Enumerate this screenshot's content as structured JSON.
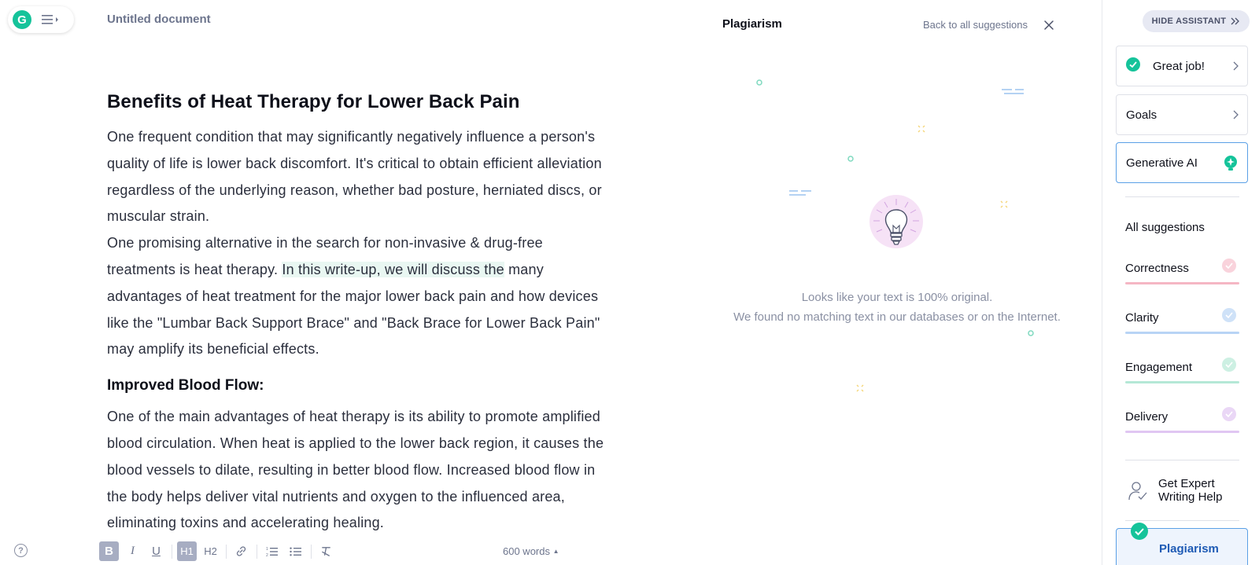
{
  "app": {
    "logo_letter": "G",
    "document_title": "Untitled document"
  },
  "editor": {
    "heading": "Benefits of Heat Therapy for Lower Back Pain",
    "para1": "One frequent condition that may significantly negatively influence a person's quality of life is lower back discomfort. It's critical to obtain efficient alleviation regardless of the underlying reason, whether bad posture, herniated discs, or muscular strain.",
    "para2_before": "One promising alternative in the search for non-invasive & drug-free treatments is heat therapy. ",
    "para2_highlight": "In this write-up, we will discuss the",
    "para2_after": " many advantages of heat treatment for the major lower back pain and how devices like the \"Lumbar Back Support Brace\" and \"Back Brace for Lower Back Pain\" may amplify its beneficial effects.",
    "subheading": "Improved Blood Flow:",
    "para3": "One of the main advantages of heat therapy is its ability to promote amplified blood circulation. When heat is applied to the lower back region, it causes the blood vessels to dilate, resulting in better blood flow. Increased blood flow in the body helps deliver vital nutrients and oxygen to the influenced area, eliminating toxins and accelerating healing."
  },
  "toolbar": {
    "bold": "B",
    "italic": "I",
    "underline": "U",
    "h1": "H1",
    "h2": "H2",
    "word_count": "600 words",
    "help": "?"
  },
  "plagiarism_panel": {
    "title": "Plagiarism",
    "back_link": "Back to all suggestions",
    "message_line1": "Looks like your text is 100% original.",
    "message_line2": "We found no matching text in our databases or on the Internet."
  },
  "sidebar": {
    "hide_button": "HIDE ASSISTANT",
    "great_job": "Great job!",
    "goals": "Goals",
    "generative_ai": "Generative AI",
    "all_suggestions": "All suggestions",
    "categories": [
      {
        "label": "Correctness",
        "color": "#f5b6c4"
      },
      {
        "label": "Clarity",
        "color": "#b8d4f5"
      },
      {
        "label": "Engagement",
        "color": "#b5e8d6"
      },
      {
        "label": "Delivery",
        "color": "#e0c6f2"
      }
    ],
    "expert_line1": "Get Expert",
    "expert_line2": "Writing Help",
    "plagiarism": "Plagiarism",
    "accent_color": "#15c39a"
  }
}
